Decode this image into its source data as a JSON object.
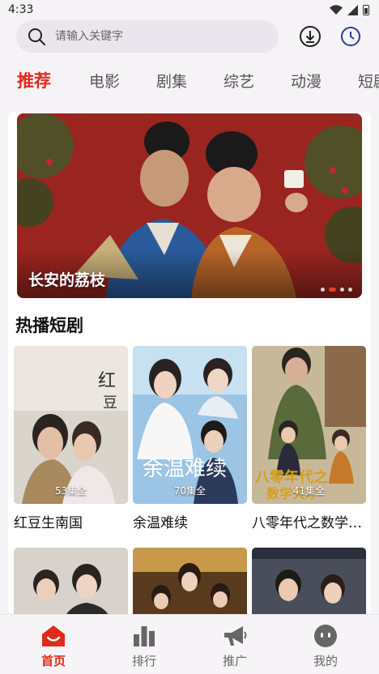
{
  "status_bar": {
    "time": "4:33"
  },
  "search": {
    "placeholder": "请输入关键字"
  },
  "tabs": [
    {
      "label": "推荐",
      "active": true
    },
    {
      "label": "电影"
    },
    {
      "label": "剧集"
    },
    {
      "label": "综艺"
    },
    {
      "label": "动漫"
    },
    {
      "label": "短剧"
    }
  ],
  "banner": {
    "title": "长安的荔枝",
    "slide_index": 2,
    "slide_count": 4
  },
  "section": {
    "title": "热播短剧",
    "items": [
      {
        "title": "红豆生南国",
        "badge": "53集全"
      },
      {
        "title": "余温难续",
        "badge": "70集全"
      },
      {
        "title": "八零年代之数学天才",
        "badge": "41集全"
      }
    ]
  },
  "bottom_nav": [
    {
      "label": "首页",
      "icon": "home-icon",
      "active": true
    },
    {
      "label": "排行",
      "icon": "bar-chart-icon"
    },
    {
      "label": "推广",
      "icon": "megaphone-icon"
    },
    {
      "label": "我的",
      "icon": "profile-face-icon"
    }
  ],
  "colors": {
    "accent": "#e02a1a",
    "background": "#f6f3f7"
  }
}
